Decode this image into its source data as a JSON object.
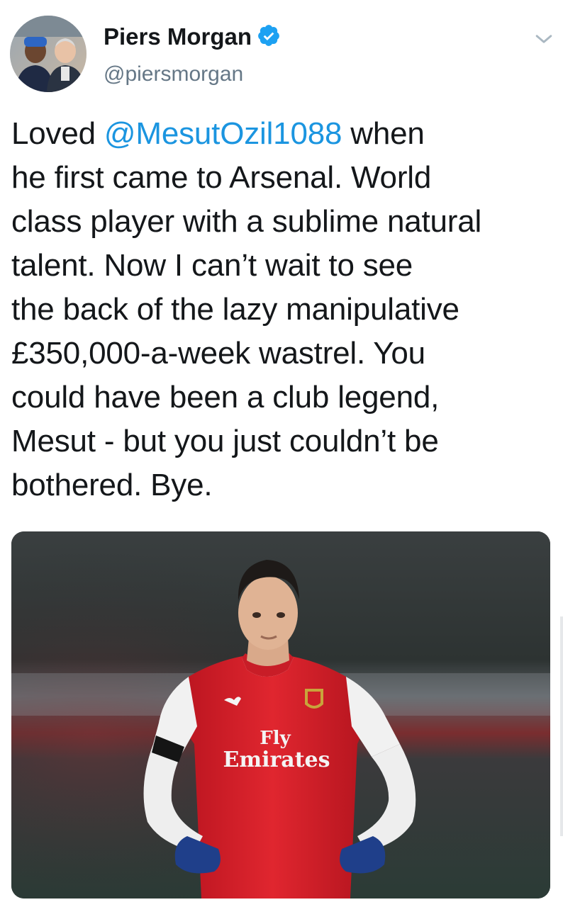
{
  "user": {
    "display_name": "Piers Morgan",
    "handle": "@piersmorgan",
    "verified": true,
    "avatar_icon": "profile-photo-icon"
  },
  "tweet": {
    "lines": [
      {
        "parts": [
          {
            "text": "Loved ",
            "mention": false
          },
          {
            "text": "@MesutOzil1088",
            "mention": true
          },
          {
            "text": " when",
            "mention": false
          }
        ]
      },
      {
        "parts": [
          {
            "text": "he first came to Arsenal. World",
            "mention": false
          }
        ]
      },
      {
        "parts": [
          {
            "text": "class player with a sublime natural",
            "mention": false
          }
        ]
      },
      {
        "parts": [
          {
            "text": "talent. Now I can’t wait to see",
            "mention": false
          }
        ]
      },
      {
        "parts": [
          {
            "text": "the back of the lazy manipulative",
            "mention": false
          }
        ]
      },
      {
        "parts": [
          {
            "text": "£350,000-a-week wastrel. You",
            "mention": false
          }
        ]
      },
      {
        "parts": [
          {
            "text": "could have been a club legend,",
            "mention": false
          }
        ]
      },
      {
        "parts": [
          {
            "text": "Mesut - but you just couldn’t be",
            "mention": false
          }
        ]
      },
      {
        "parts": [
          {
            "text": "bothered. Bye.",
            "mention": false
          }
        ]
      }
    ]
  },
  "media": {
    "shirt_sponsor_line1": "Fly",
    "shirt_sponsor_line2": "Emirates",
    "kit_brand_icon": "puma-logo-icon",
    "crest_icon": "arsenal-crest-icon"
  },
  "colors": {
    "text": "#14171a",
    "secondary": "#657786",
    "mention": "#1b95e0",
    "verified": "#1da1f2",
    "kit_red": "#d6202a",
    "kit_white": "#f2f2f2",
    "gloves": "#1f3f8a"
  }
}
